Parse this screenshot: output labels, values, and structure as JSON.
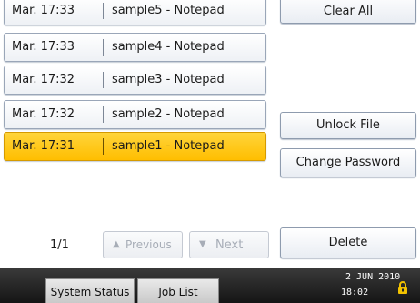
{
  "files": [
    {
      "time": "Mar. 17:33",
      "doc": "sample5 - Notepad",
      "selected": false
    },
    {
      "time": "Mar. 17:33",
      "doc": "sample4 - Notepad",
      "selected": false
    },
    {
      "time": "Mar. 17:32",
      "doc": "sample3 - Notepad",
      "selected": false
    },
    {
      "time": "Mar. 17:32",
      "doc": "sample2 - Notepad",
      "selected": false
    },
    {
      "time": "Mar. 17:31",
      "doc": "sample1 - Notepad",
      "selected": true
    }
  ],
  "actions": {
    "clear_all": "Clear All",
    "unlock_file": "Unlock File",
    "change_password": "Change Password",
    "delete": "Delete"
  },
  "pager": {
    "indicator": "1/1",
    "previous": "Previous",
    "next": "Next",
    "previous_icon": "triangle-up-icon",
    "next_icon": "triangle-down-icon"
  },
  "statusbar": {
    "system_status": "System Status",
    "job_list": "Job List",
    "date": "2 JUN  2010",
    "time": "18:02",
    "lock_icon": "lock-icon"
  },
  "colors": {
    "selected": "#ffc400",
    "statusbar": "#1f1f1f"
  }
}
